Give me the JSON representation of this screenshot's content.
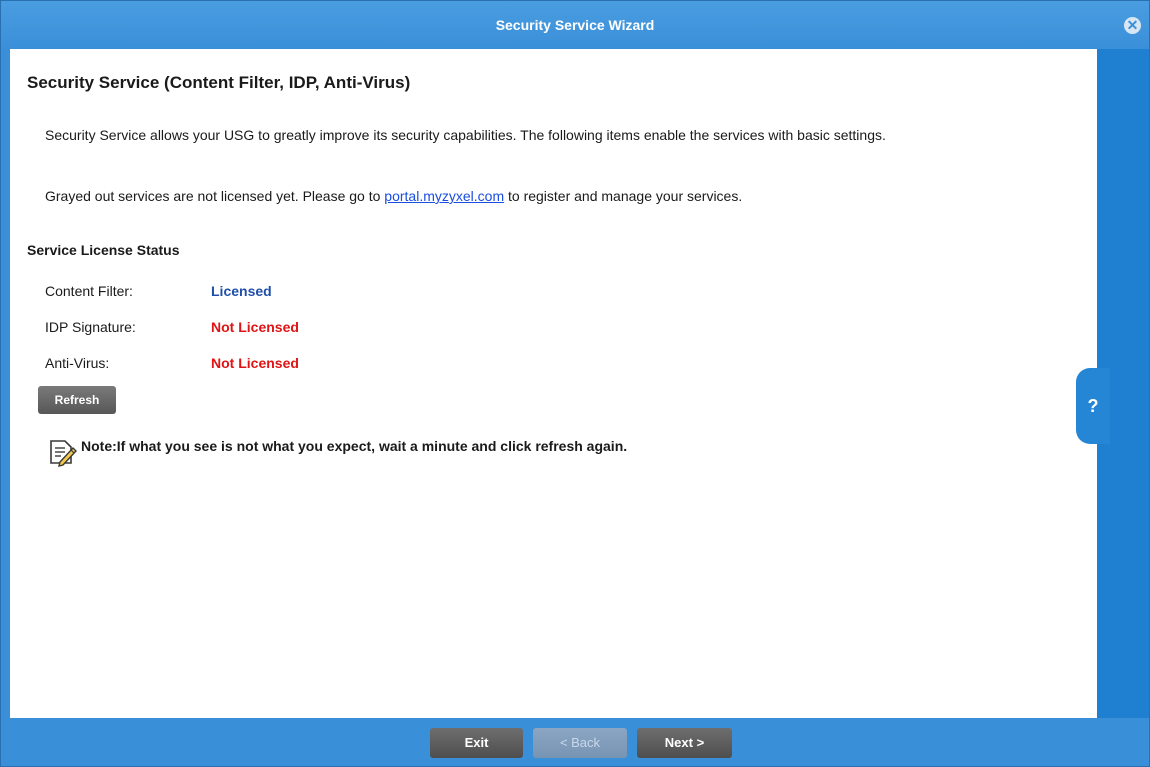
{
  "window": {
    "title": "Security Service Wizard",
    "close_icon": "close-icon"
  },
  "main": {
    "title": "Security Service (Content Filter, IDP, Anti-Virus)",
    "intro": "Security Service allows your USG to greatly improve its security capabilities. The following items enable the services with basic settings.",
    "grayed_prefix": "Grayed out services are not licensed yet. Please go to ",
    "portal_link": "portal.myzyxel.com",
    "grayed_suffix": " to register and manage your services.",
    "section_title": "Service License Status",
    "services": [
      {
        "label": "Content Filter:",
        "status": "Licensed"
      },
      {
        "label": "IDP Signature:",
        "status": "Not Licensed"
      },
      {
        "label": "Anti-Virus:",
        "status": "Not Licensed"
      }
    ],
    "refresh_label": "Refresh",
    "note": "Note:If what you see is not what you expect, wait a minute and click refresh again.",
    "note_icon": "note-pencil-icon"
  },
  "help": {
    "label": "?"
  },
  "footer": {
    "exit_label": "Exit",
    "back_label": "< Back",
    "next_label": "Next >"
  },
  "colors": {
    "title_bar": "#3a8fd9",
    "licensed": "#1f4fa8",
    "not_licensed": "#e01414",
    "link": "#1a4de0"
  }
}
